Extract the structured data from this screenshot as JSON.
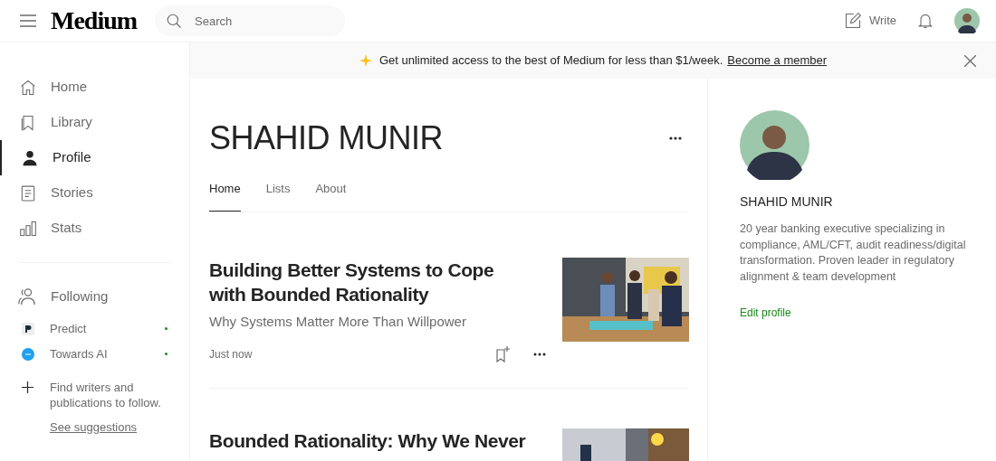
{
  "header": {
    "logo": "Medium",
    "search": {
      "placeholder": "Search"
    },
    "write_label": "Write"
  },
  "banner": {
    "text": "Get unlimited access to the best of Medium for less than $1/week.",
    "link": "Become a member"
  },
  "sidebar": {
    "items": [
      {
        "label": "Home",
        "selected": false
      },
      {
        "label": "Library",
        "selected": false
      },
      {
        "label": "Profile",
        "selected": true
      },
      {
        "label": "Stories",
        "selected": false
      },
      {
        "label": "Stats",
        "selected": false
      }
    ],
    "following": {
      "label": "Following",
      "publications": [
        {
          "name": "Predict",
          "kind": "letter",
          "has_new": true
        },
        {
          "name": "Towards AI",
          "kind": "circle",
          "has_new": true
        }
      ],
      "hint": "Find writers and publications to follow.",
      "link": "See suggestions"
    }
  },
  "profile": {
    "name": "SHAHID MUNIR",
    "tabs": [
      {
        "label": "Home",
        "selected": true
      },
      {
        "label": "Lists",
        "selected": false
      },
      {
        "label": "About",
        "selected": false
      }
    ]
  },
  "stories": [
    {
      "title": "Building Better Systems to Cope with Bounded Rationality",
      "subtitle": "Why Systems Matter More Than Willpower",
      "time": "Just now"
    },
    {
      "title": "Bounded Rationality: Why We Never"
    }
  ],
  "about": {
    "name": "SHAHID MUNIR",
    "bio": "20 year banking executive specializing in compliance, AML/CFT, audit readiness/digital transformation. Proven leader in regulatory alignment & team development",
    "edit_link": "Edit profile"
  }
}
